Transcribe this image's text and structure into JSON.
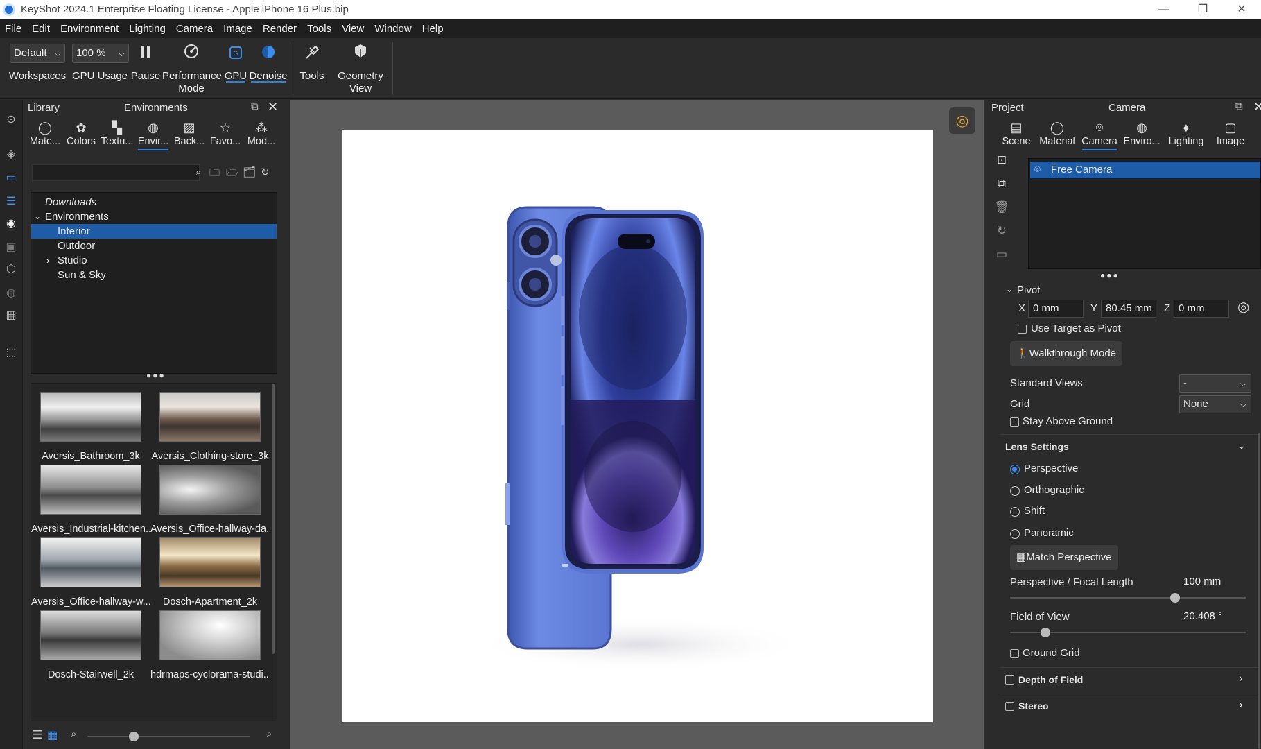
{
  "window": {
    "title": "KeyShot 2024.1 Enterprise Floating License  - Apple iPhone 16 Plus.bip",
    "minimize": "—",
    "maximize": "❐",
    "close": "✕"
  },
  "menu": [
    "File",
    "Edit",
    "Environment",
    "Lighting",
    "Camera",
    "Image",
    "Render",
    "Tools",
    "View",
    "Window",
    "Help"
  ],
  "ribbon": {
    "workspace_value": "Default",
    "workspaces_label": "Workspaces",
    "gpu_usage_value": "100 %",
    "gpu_usage_label": "GPU Usage",
    "pause_label": "Pause",
    "performance_label_1": "Performance",
    "performance_label_2": "Mode",
    "gpu_label": "GPU",
    "denoise_label": "Denoise",
    "tools_label": "Tools",
    "geometry_label_1": "Geometry",
    "geometry_label_2": "View"
  },
  "library": {
    "title": "Library",
    "subtitle": "Environments",
    "tabs": [
      {
        "label": "Mate...",
        "icon": "material-icon"
      },
      {
        "label": "Colors",
        "icon": "palette-icon"
      },
      {
        "label": "Textu...",
        "icon": "texture-icon"
      },
      {
        "label": "Envir...",
        "icon": "globe-icon"
      },
      {
        "label": "Back...",
        "icon": "image-icon"
      },
      {
        "label": "Favo...",
        "icon": "star-icon"
      },
      {
        "label": "Mod...",
        "icon": "models-icon"
      }
    ],
    "search_placeholder": "",
    "tree": [
      {
        "label": "Downloads",
        "italic": true
      },
      {
        "label": "Environments",
        "expanded": true
      },
      {
        "label": "Interior",
        "selected": true
      },
      {
        "label": "Outdoor"
      },
      {
        "label": "Studio",
        "collapsed": true
      },
      {
        "label": "Sun & Sky"
      }
    ],
    "thumbnails": [
      "Aversis_Bathroom_3k",
      "Aversis_Clothing-store_3k",
      "Aversis_Industrial-kitchen...",
      "Aversis_Office-hallway-da...",
      "Aversis_Office-hallway-w...",
      "Dosch-Apartment_2k",
      "Dosch-Stairwell_2k",
      "hdrmaps-cyclorama-studi..."
    ]
  },
  "right": {
    "title": "Project",
    "subtitle": "Camera",
    "tabs": [
      {
        "label": "Scene",
        "icon": "list-icon"
      },
      {
        "label": "Material",
        "icon": "material-icon"
      },
      {
        "label": "Camera",
        "icon": "camera-icon"
      },
      {
        "label": "Enviro...",
        "icon": "globe-icon"
      },
      {
        "label": "Lighting",
        "icon": "bulb-icon"
      },
      {
        "label": "Image",
        "icon": "frame-icon"
      }
    ],
    "camera_item": "Free Camera",
    "pivot_label": "Pivot",
    "x_label": "X",
    "y_label": "Y",
    "z_label": "Z",
    "pivot_x": "0 mm",
    "pivot_y": "80.45 mm",
    "pivot_z": "0 mm",
    "use_target_pivot": "Use Target as Pivot",
    "walkthrough": "Walkthrough Mode",
    "standard_views_label": "Standard Views",
    "standard_views_value": "-",
    "grid_label": "Grid",
    "grid_value": "None",
    "stay_above_ground": "Stay Above Ground",
    "lens_settings": "Lens Settings",
    "lens_options": [
      "Perspective",
      "Orthographic",
      "Shift",
      "Panoramic"
    ],
    "lens_selected": "Perspective",
    "match_perspective": "Match Perspective",
    "focal_length_label": "Perspective / Focal Length",
    "focal_length_value": "100 mm",
    "focal_slider": 0.7,
    "fov_label": "Field of View",
    "fov_value": "20.408 °",
    "fov_slider": 0.15,
    "ground_grid": "Ground Grid",
    "depth_of_field": "Depth of Field",
    "stereo": "Stereo"
  },
  "colors": {
    "accent": "#2f7fe0",
    "selection": "#1f5ca8",
    "phone_body": "#5b78d6",
    "panel_bg": "#2b2b2b"
  }
}
